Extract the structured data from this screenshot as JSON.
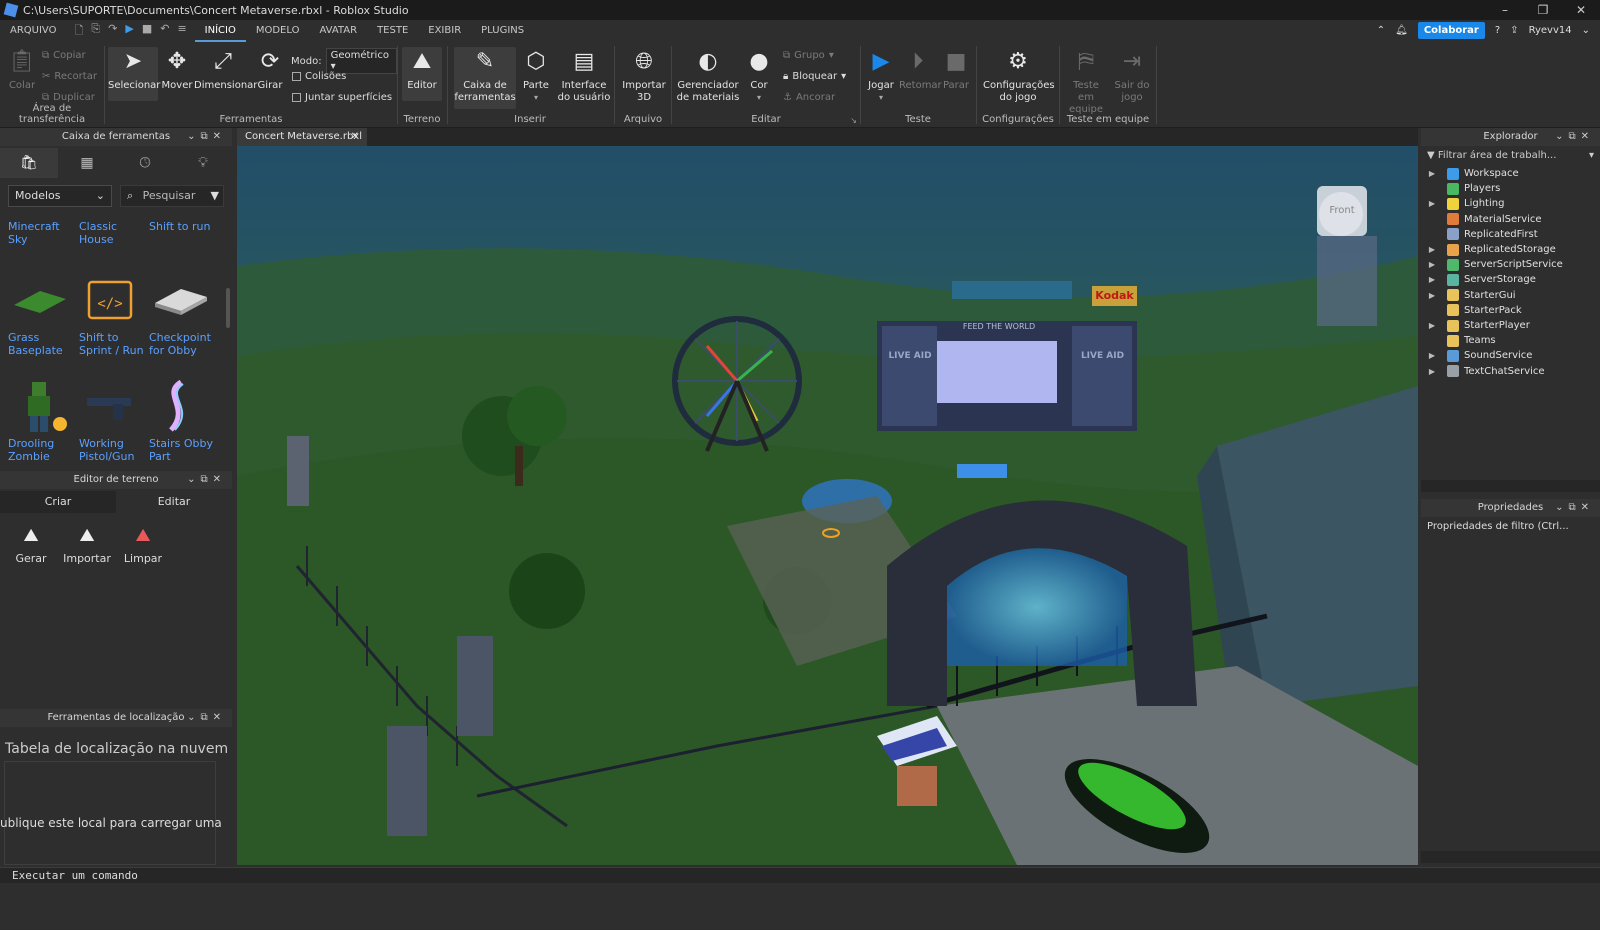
{
  "window": {
    "title": "C:\\Users\\SUPORTE\\Documents\\Concert Metaverse.rbxl - Roblox Studio",
    "controls": [
      "–",
      "❐",
      "✕"
    ]
  },
  "menu": {
    "file": "ARQUIVO",
    "tabs": [
      "INÍCIO",
      "MODELO",
      "AVATAR",
      "TESTE",
      "EXIBIR",
      "PLUGINS"
    ],
    "collaborate": "Colaborar",
    "user": "Ryevv14"
  },
  "ribbon": {
    "clipboard": {
      "paste": "Colar",
      "copy": "Copiar",
      "cut": "Recortar",
      "duplicate": "Duplicar",
      "label": "Área de transferência"
    },
    "tools": {
      "select": "Selecionar",
      "move": "Mover",
      "scale": "Dimensionar",
      "rotate": "Girar",
      "mode_label": "Modo:",
      "mode_value": "Geométrico",
      "collisions": "Colisões",
      "join": "Juntar superfícies",
      "label": "Ferramentas"
    },
    "terrain": {
      "editor": "Editor",
      "label": "Terreno"
    },
    "insert": {
      "toolbox": "Caixa de ferramentas",
      "part": "Parte",
      "ui": "Interface do usuário",
      "label": "Inserir"
    },
    "file": {
      "import3d": "Importar 3D",
      "label": "Arquivo"
    },
    "edit": {
      "materials": "Gerenciador de materiais",
      "color": "Cor",
      "group": "Grupo",
      "lock": "Bloquear",
      "anchor": "Ancorar",
      "label": "Editar"
    },
    "test": {
      "play": "Jogar",
      "resume": "Retomar",
      "stop": "Parar",
      "label": "Teste"
    },
    "settings": {
      "game_settings": "Configurações do jogo",
      "label": "Configurações"
    },
    "team_test": {
      "team_test": "Teste em equipe",
      "exit_game": "Sair do jogo",
      "label": "Teste em equipe"
    }
  },
  "toolbox": {
    "title": "Caixa de ferramentas",
    "category": "Modelos",
    "search_placeholder": "Pesquisar",
    "items": [
      [
        "Minecraft",
        "Sky"
      ],
      [
        "Classic",
        "House"
      ],
      [
        "Shift to run",
        ""
      ],
      [
        "Grass",
        "Baseplate"
      ],
      [
        "Shift to",
        "Sprint / Run"
      ],
      [
        "Checkpoint",
        "for Obby"
      ],
      [
        "Drooling",
        "Zombie"
      ],
      [
        "Working",
        "Pistol/Gun"
      ],
      [
        "Stairs Obby",
        "Part"
      ]
    ]
  },
  "terrain_editor": {
    "title": "Editor de terreno",
    "tabs": [
      "Criar",
      "Editar"
    ],
    "buttons": [
      "Gerar",
      "Importar",
      "Limpar"
    ]
  },
  "localization": {
    "title": "Ferramentas de localização",
    "heading": "Tabela de localização na nuvem",
    "message": "ublique este local para carregar uma tabel"
  },
  "viewport": {
    "tab": "Concert Metaverse.rbxl",
    "view_cube_label": "Front",
    "sign_text": "Kodak",
    "banner_text": "FEED THE WORLD",
    "screen_text": "LIVE AID"
  },
  "explorer": {
    "title": "Explorador",
    "filter": "Filtrar área de trabalh...",
    "items": [
      {
        "name": "Workspace",
        "expandable": true,
        "color": "#3d9be9"
      },
      {
        "name": "Players",
        "expandable": false,
        "color": "#48b863"
      },
      {
        "name": "Lighting",
        "expandable": true,
        "color": "#f0d23b"
      },
      {
        "name": "MaterialService",
        "expandable": false,
        "color": "#e07b39"
      },
      {
        "name": "ReplicatedFirst",
        "expandable": false,
        "color": "#8aa0c8"
      },
      {
        "name": "ReplicatedStorage",
        "expandable": true,
        "color": "#e8a34a"
      },
      {
        "name": "ServerScriptService",
        "expandable": true,
        "color": "#4fb86a"
      },
      {
        "name": "ServerStorage",
        "expandable": true,
        "color": "#5ab5a0"
      },
      {
        "name": "StarterGui",
        "expandable": true,
        "color": "#e8c25a"
      },
      {
        "name": "StarterPack",
        "expandable": false,
        "color": "#e8c25a"
      },
      {
        "name": "StarterPlayer",
        "expandable": true,
        "color": "#e8c25a"
      },
      {
        "name": "Teams",
        "expandable": false,
        "color": "#e8c25a"
      },
      {
        "name": "SoundService",
        "expandable": true,
        "color": "#5b9bd5"
      },
      {
        "name": "TextChatService",
        "expandable": true,
        "color": "#9aa0a8"
      }
    ]
  },
  "properties": {
    "title": "Propriedades",
    "filter": "Propriedades de filtro (Ctrl..."
  },
  "command_bar": {
    "placeholder": "Executar um comando"
  },
  "colors": {
    "accent": "#1a88e8",
    "link": "#5aa0ff",
    "panel": "#2e2e2e"
  }
}
